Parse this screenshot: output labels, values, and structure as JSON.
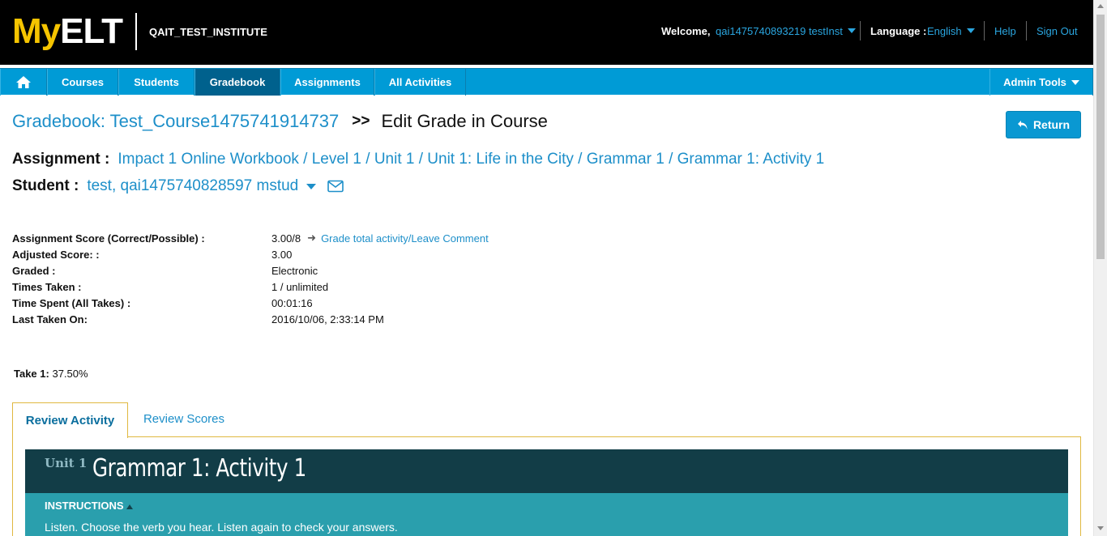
{
  "header": {
    "logo_my": "My",
    "logo_elt": "ELT",
    "institute": "QAIT_TEST_INSTITUTE",
    "welcome_label": "Welcome,",
    "user_name": "qai1475740893219 testInst",
    "language_label": "Language :",
    "language_value": "English",
    "help": "Help",
    "sign_out": "Sign Out"
  },
  "nav": {
    "home_icon": "home-icon",
    "items": [
      "Courses",
      "Students",
      "Gradebook",
      "Assignments",
      "All Activities"
    ],
    "active": "Gradebook",
    "admin_tools": "Admin Tools"
  },
  "page": {
    "gradebook_link": "Gradebook: Test_Course1475741914737",
    "separator": ">>",
    "current": "Edit Grade in Course",
    "return_button": "Return",
    "assignment_label": "Assignment :",
    "assignment_path": "Impact 1 Online Workbook / Level 1 / Unit 1 / Unit 1: Life in the City / Grammar 1 / Grammar 1: Activity 1",
    "student_label": "Student :",
    "student_name": "test, qai1475740828597 mstud"
  },
  "scores": {
    "rows": [
      {
        "label": "Assignment Score (Correct/Possible) :",
        "value": "3.00/8"
      },
      {
        "label": "Adjusted Score: :",
        "value": "3.00"
      },
      {
        "label": "Graded :",
        "value": "Electronic"
      },
      {
        "label": "Times Taken :",
        "value": "1 / unlimited"
      },
      {
        "label": "Time Spent (All Takes) :",
        "value": "00:01:16"
      },
      {
        "label": "Last Taken On:",
        "value": "2016/10/06, 2:33:14 PM"
      }
    ],
    "grade_link": "Grade total activity/Leave Comment",
    "take_label": "Take 1:",
    "take_value": "37.50%"
  },
  "tabs": {
    "review_activity": "Review Activity",
    "review_scores": "Review Scores"
  },
  "activity": {
    "unit": "Unit 1",
    "title": "Grammar 1: Activity 1",
    "instructions_title": "INSTRUCTIONS",
    "instructions_text": "Listen. Choose the verb you hear. Listen again to check your answers."
  }
}
